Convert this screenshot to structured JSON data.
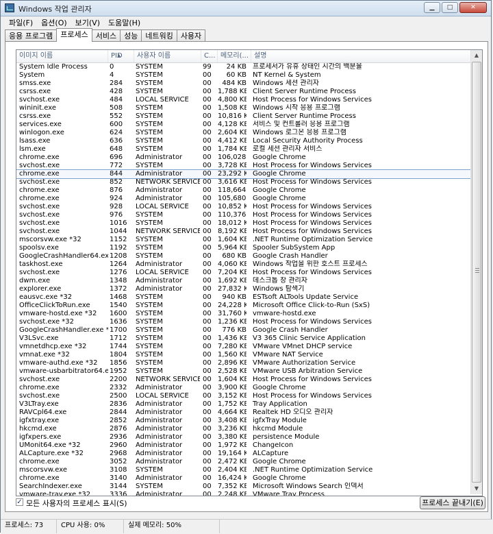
{
  "window": {
    "title": "Windows 작업 관리자",
    "min_glyph": "▁",
    "max_glyph": "□",
    "close_glyph": "✕"
  },
  "menu": [
    "파일(F)",
    "옵션(O)",
    "보기(V)",
    "도움말(H)"
  ],
  "tabs": [
    {
      "label": "응용 프로그램",
      "active": false
    },
    {
      "label": "프로세스",
      "active": true
    },
    {
      "label": "서비스",
      "active": false
    },
    {
      "label": "성능",
      "active": false
    },
    {
      "label": "네트워킹",
      "active": false
    },
    {
      "label": "사용자",
      "active": false
    }
  ],
  "columns": {
    "name": "이미지 이름",
    "pid": "PID",
    "user": "사용자 이름",
    "cpu": "C...",
    "mem": "메모리(...",
    "desc": "설명"
  },
  "processes": [
    {
      "name": "System Idle Process",
      "pid": "0",
      "user": "SYSTEM",
      "cpu": "99",
      "mem": "24 KB",
      "desc": "프로세서가 유휴 상태인 시간의 백분율"
    },
    {
      "name": "System",
      "pid": "4",
      "user": "SYSTEM",
      "cpu": "00",
      "mem": "60 KB",
      "desc": "NT Kernel & System"
    },
    {
      "name": "smss.exe",
      "pid": "284",
      "user": "SYSTEM",
      "cpu": "00",
      "mem": "484 KB",
      "desc": "Windows 세션 관리자"
    },
    {
      "name": "csrss.exe",
      "pid": "428",
      "user": "SYSTEM",
      "cpu": "00",
      "mem": "1,788 KB",
      "desc": "Client Server Runtime Process"
    },
    {
      "name": "svchost.exe",
      "pid": "484",
      "user": "LOCAL SERVICE",
      "cpu": "00",
      "mem": "4,800 KB",
      "desc": "Host Process for Windows Services"
    },
    {
      "name": "wininit.exe",
      "pid": "508",
      "user": "SYSTEM",
      "cpu": "00",
      "mem": "1,508 KB",
      "desc": "Windows 시작 응용 프로그램"
    },
    {
      "name": "csrss.exe",
      "pid": "552",
      "user": "SYSTEM",
      "cpu": "00",
      "mem": "10,816 KB",
      "desc": "Client Server Runtime Process"
    },
    {
      "name": "services.exe",
      "pid": "600",
      "user": "SYSTEM",
      "cpu": "00",
      "mem": "4,128 KB",
      "desc": "서비스 및 컨트롤러 응용 프로그램"
    },
    {
      "name": "winlogon.exe",
      "pid": "624",
      "user": "SYSTEM",
      "cpu": "00",
      "mem": "2,604 KB",
      "desc": "Windows 로그온 응용 프로그램"
    },
    {
      "name": "lsass.exe",
      "pid": "636",
      "user": "SYSTEM",
      "cpu": "00",
      "mem": "4,412 KB",
      "desc": "Local Security Authority Process"
    },
    {
      "name": "lsm.exe",
      "pid": "648",
      "user": "SYSTEM",
      "cpu": "00",
      "mem": "1,784 KB",
      "desc": "로컬 세션 관리자 서비스"
    },
    {
      "name": "chrome.exe",
      "pid": "696",
      "user": "Administrator",
      "cpu": "00",
      "mem": "106,028...",
      "desc": "Google Chrome"
    },
    {
      "name": "svchost.exe",
      "pid": "772",
      "user": "SYSTEM",
      "cpu": "00",
      "mem": "3,728 KB",
      "desc": "Host Process for Windows Services"
    },
    {
      "name": "chrome.exe",
      "pid": "844",
      "user": "Administrator",
      "cpu": "00",
      "mem": "23,292 KB",
      "desc": "Google Chrome",
      "selected": true
    },
    {
      "name": "svchost.exe",
      "pid": "852",
      "user": "NETWORK SERVICE",
      "cpu": "00",
      "mem": "3,616 KB",
      "desc": "Host Process for Windows Services"
    },
    {
      "name": "chrome.exe",
      "pid": "876",
      "user": "Administrator",
      "cpu": "00",
      "mem": "118,664...",
      "desc": "Google Chrome"
    },
    {
      "name": "chrome.exe",
      "pid": "924",
      "user": "Administrator",
      "cpu": "00",
      "mem": "105,680...",
      "desc": "Google Chrome"
    },
    {
      "name": "svchost.exe",
      "pid": "928",
      "user": "LOCAL SERVICE",
      "cpu": "00",
      "mem": "10,852 KB",
      "desc": "Host Process for Windows Services"
    },
    {
      "name": "svchost.exe",
      "pid": "976",
      "user": "SYSTEM",
      "cpu": "00",
      "mem": "110,376...",
      "desc": "Host Process for Windows Services"
    },
    {
      "name": "svchost.exe",
      "pid": "1016",
      "user": "SYSTEM",
      "cpu": "00",
      "mem": "18,012 KB",
      "desc": "Host Process for Windows Services"
    },
    {
      "name": "svchost.exe",
      "pid": "1044",
      "user": "NETWORK SERVICE",
      "cpu": "00",
      "mem": "8,192 KB",
      "desc": "Host Process for Windows Services"
    },
    {
      "name": "mscorsvw.exe *32",
      "pid": "1152",
      "user": "SYSTEM",
      "cpu": "00",
      "mem": "1,604 KB",
      ".desc": "",
      "desc": ".NET Runtime Optimization Service"
    },
    {
      "name": "spoolsv.exe",
      "pid": "1192",
      "user": "SYSTEM",
      "cpu": "00",
      "mem": "5,964 KB",
      "desc": "Spooler SubSystem App"
    },
    {
      "name": "GoogleCrashHandler64.exe",
      "pid": "1208",
      "user": "SYSTEM",
      "cpu": "00",
      "mem": "680 KB",
      "desc": "Google Crash Handler"
    },
    {
      "name": "taskhost.exe",
      "pid": "1264",
      "user": "Administrator",
      "cpu": "00",
      "mem": "4,060 KB",
      "desc": "Windows 작업을 위한 호스트 프로세스"
    },
    {
      "name": "svchost.exe",
      "pid": "1276",
      "user": "LOCAL SERVICE",
      "cpu": "00",
      "mem": "7,204 KB",
      "desc": "Host Process for Windows Services"
    },
    {
      "name": "dwm.exe",
      "pid": "1348",
      "user": "Administrator",
      "cpu": "00",
      "mem": "1,692 KB",
      "desc": "데스크톱 창 관리자"
    },
    {
      "name": "explorer.exe",
      "pid": "1372",
      "user": "Administrator",
      "cpu": "00",
      "mem": "27,832 KB",
      "desc": "Windows 탐색기"
    },
    {
      "name": "eausvc.exe *32",
      "pid": "1468",
      "user": "SYSTEM",
      "cpu": "00",
      "mem": "940 KB",
      "desc": "ESTsoft ALTools Update Service"
    },
    {
      "name": "OfficeClickToRun.exe",
      "pid": "1540",
      "user": "SYSTEM",
      "cpu": "00",
      "mem": "24,228 KB",
      "desc": "Microsoft Office Click-to-Run (SxS)"
    },
    {
      "name": "vmware-hostd.exe *32",
      "pid": "1600",
      "user": "SYSTEM",
      "cpu": "00",
      "mem": "31,760 KB",
      "desc": "vmware-hostd.exe"
    },
    {
      "name": "svchost.exe *32",
      "pid": "1636",
      "user": "SYSTEM",
      "cpu": "00",
      "mem": "1,236 KB",
      "desc": "Host Process for Windows Services"
    },
    {
      "name": "GoogleCrashHandler.exe *32",
      "pid": "1700",
      "user": "SYSTEM",
      "cpu": "00",
      "mem": "776 KB",
      "desc": "Google Crash Handler"
    },
    {
      "name": "V3LSvc.exe",
      "pid": "1712",
      "user": "SYSTEM",
      "cpu": "00",
      "mem": "1,436 KB",
      "desc": "V3 365 Clinic Service Application"
    },
    {
      "name": "vmnetdhcp.exe *32",
      "pid": "1744",
      "user": "SYSTEM",
      "cpu": "00",
      "mem": "7,280 KB",
      "desc": "VMware VMnet DHCP service"
    },
    {
      "name": "vmnat.exe *32",
      "pid": "1804",
      "user": "SYSTEM",
      "cpu": "00",
      "mem": "1,560 KB",
      "desc": "VMware NAT Service"
    },
    {
      "name": "vmware-authd.exe *32",
      "pid": "1856",
      "user": "SYSTEM",
      "cpu": "00",
      "mem": "2,896 KB",
      "desc": "VMware Authorization Service"
    },
    {
      "name": "vmware-usbarbitrator64.exe",
      "pid": "1952",
      "user": "SYSTEM",
      "cpu": "00",
      "mem": "2,528 KB",
      "desc": "VMware USB Arbitration Service"
    },
    {
      "name": "svchost.exe",
      "pid": "2200",
      "user": "NETWORK SERVICE",
      "cpu": "00",
      "mem": "1,604 KB",
      "desc": "Host Process for Windows Services"
    },
    {
      "name": "chrome.exe",
      "pid": "2332",
      "user": "Administrator",
      "cpu": "00",
      "mem": "3,900 KB",
      "desc": "Google Chrome"
    },
    {
      "name": "svchost.exe",
      "pid": "2500",
      "user": "LOCAL SERVICE",
      "cpu": "00",
      "mem": "3,152 KB",
      "desc": "Host Process for Windows Services"
    },
    {
      "name": "V3LTray.exe",
      "pid": "2836",
      "user": "Administrator",
      "cpu": "00",
      "mem": "1,752 KB",
      "desc": "Tray Application"
    },
    {
      "name": "RAVCpl64.exe",
      "pid": "2844",
      "user": "Administrator",
      "cpu": "00",
      "mem": "4,664 KB",
      "desc": "Realtek HD 오디오 관리자"
    },
    {
      "name": "igfxtray.exe",
      "pid": "2852",
      "user": "Administrator",
      "cpu": "00",
      "mem": "3,408 KB",
      "desc": "igfxTray Module"
    },
    {
      "name": "hkcmd.exe",
      "pid": "2876",
      "user": "Administrator",
      "cpu": "00",
      "mem": "3,236 KB",
      "desc": "hkcmd Module"
    },
    {
      "name": "igfxpers.exe",
      "pid": "2936",
      "user": "Administrator",
      "cpu": "00",
      "mem": "3,380 KB",
      "desc": "persistence Module"
    },
    {
      "name": "UMonit64.exe *32",
      "pid": "2960",
      "user": "Administrator",
      "cpu": "00",
      "mem": "1,972 KB",
      "desc": "ChangeIcon"
    },
    {
      "name": "ALCapture.exe *32",
      "pid": "2968",
      "user": "Administrator",
      "cpu": "00",
      "mem": "19,164 KB",
      "desc": "ALCapture"
    },
    {
      "name": "chrome.exe",
      "pid": "3052",
      "user": "Administrator",
      "cpu": "00",
      "mem": "2,472 KB",
      "desc": "Google Chrome"
    },
    {
      "name": "mscorsvw.exe",
      "pid": "3108",
      "user": "SYSTEM",
      "cpu": "00",
      "mem": "2,404 KB",
      "desc": ".NET Runtime Optimization Service"
    },
    {
      "name": "chrome.exe",
      "pid": "3140",
      "user": "Administrator",
      "cpu": "00",
      "mem": "16,424 KB",
      "desc": "Google Chrome"
    },
    {
      "name": "SearchIndexer.exe",
      "pid": "3144",
      "user": "SYSTEM",
      "cpu": "00",
      "mem": "7,352 KB",
      "desc": "Microsoft Windows Search 인덱서"
    },
    {
      "name": "vmware-tray.exe *32",
      "pid": "3336",
      "user": "Administrator",
      "cpu": "00",
      "mem": "2,248 KB",
      "desc": "VMware Tray Process"
    }
  ],
  "show_all_users": {
    "label": "모든 사용자의 프로세스 표시(S)",
    "checked": true,
    "check_glyph": "✓"
  },
  "end_process_button": "프로세스 끝내기(E)",
  "status": {
    "processes": "프로세스: 73",
    "cpu": "CPU 사용: 0%",
    "memory": "실제 메모리: 50%"
  },
  "scroll_glyphs": {
    "up": "▲",
    "down": "▼",
    "sort": "▲"
  }
}
